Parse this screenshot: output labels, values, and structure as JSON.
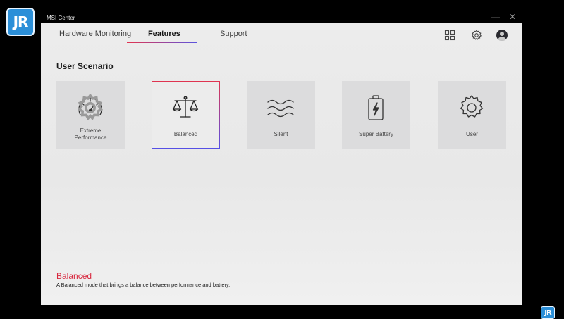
{
  "app": {
    "title": "MSI Center",
    "logo_text": "JR"
  },
  "tabs": [
    {
      "label": "Hardware Monitoring",
      "active": false
    },
    {
      "label": "Features",
      "active": true
    },
    {
      "label": "Support",
      "active": false
    }
  ],
  "toolbar": {
    "icons": [
      "grid-icon",
      "settings-icon",
      "avatar"
    ]
  },
  "section": {
    "title": "User Scenario"
  },
  "scenarios": [
    {
      "label_line1": "Extreme",
      "label_line2": "Performance",
      "icon": "speedometer-icon",
      "selected": false
    },
    {
      "label": "Balanced",
      "icon": "scale-icon",
      "selected": true
    },
    {
      "label": "Silent",
      "icon": "waves-icon",
      "selected": false
    },
    {
      "label": "Super Battery",
      "icon": "battery-icon",
      "selected": false
    },
    {
      "label": "User",
      "icon": "gear-icon",
      "selected": false
    }
  ],
  "description": {
    "mode": "Balanced",
    "text": "A Balanced mode that brings a balance between performance and battery."
  },
  "colors": {
    "accent_red": "#d8283f",
    "accent_blue": "#5650e6",
    "card_bg": "#dcdcdd"
  }
}
